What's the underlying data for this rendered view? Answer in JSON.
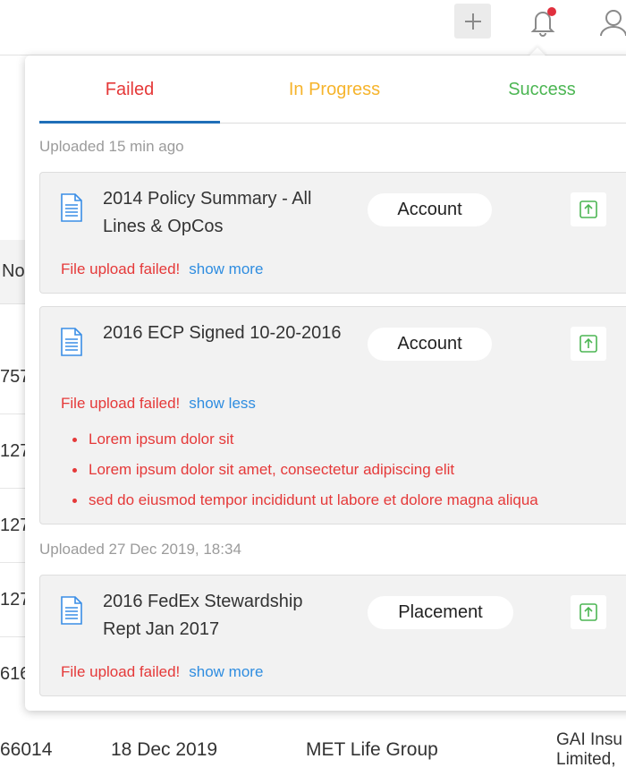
{
  "background_table": {
    "header_fragment": "No",
    "row_fragments": [
      "757",
      "127",
      "127",
      "127",
      "616"
    ],
    "last_row": {
      "id_fragment": "66014",
      "date": "18 Dec 2019",
      "client": "MET Life Group",
      "insurer_line1": "GAI Insu",
      "insurer_line2": "Limited,"
    }
  },
  "topbar": {
    "add_icon": "plus-icon",
    "notification_icon": "bell-icon",
    "notification_dot_color": "#e0303e",
    "profile_icon": "user-icon"
  },
  "popup": {
    "tabs": [
      {
        "label": "Failed",
        "color": "#e53939",
        "active": true
      },
      {
        "label": "In Progress",
        "color": "#f6b42c",
        "active": false
      },
      {
        "label": "Success",
        "color": "#4cb653",
        "active": false
      }
    ],
    "groups": [
      {
        "label": "Uploaded 15 min ago",
        "items": [
          {
            "title": "2014 Policy Summary - All Lines & OpCos",
            "tag": "Account",
            "status": "File upload failed!",
            "toggle": "show more",
            "errors": []
          },
          {
            "title": "2016 ECP Signed 10-20-2016",
            "tag": "Account",
            "status": "File upload failed!",
            "toggle": "show less",
            "errors": [
              "Lorem ipsum dolor sit",
              "Lorem ipsum dolor sit amet, consectetur adipiscing elit",
              "sed do eiusmod tempor incididunt ut labore et dolore magna aliqua"
            ]
          }
        ]
      },
      {
        "label": "Uploaded 27 Dec 2019, 18:34",
        "items": [
          {
            "title": "2016 FedEx Stewardship Rept Jan 2017",
            "tag": "Placement",
            "status": "File upload failed!",
            "toggle": "show more",
            "errors": []
          }
        ]
      }
    ]
  }
}
